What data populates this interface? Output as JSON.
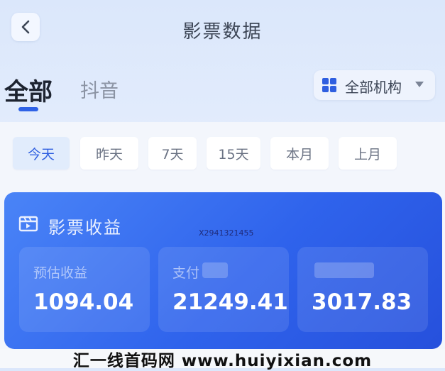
{
  "header": {
    "title": "影票数据"
  },
  "tabs": [
    {
      "label": "全部"
    },
    {
      "label": "抖音"
    }
  ],
  "org_filter": {
    "label": "全部机构"
  },
  "date_chips": [
    {
      "label": "今天"
    },
    {
      "label": "昨天"
    },
    {
      "label": "7天"
    },
    {
      "label": "15天"
    },
    {
      "label": "本月"
    },
    {
      "label": "上月"
    }
  ],
  "revenue_card": {
    "title": "影票收益",
    "watermark": "X2941321455",
    "stats": [
      {
        "label": "预估收益",
        "value": "1094.04"
      },
      {
        "label": "支付",
        "value": "21249.41"
      },
      {
        "label": "",
        "value": "3017.83"
      }
    ]
  },
  "footer": {
    "text": "汇一线首码网 www.huiyixian.com"
  }
}
